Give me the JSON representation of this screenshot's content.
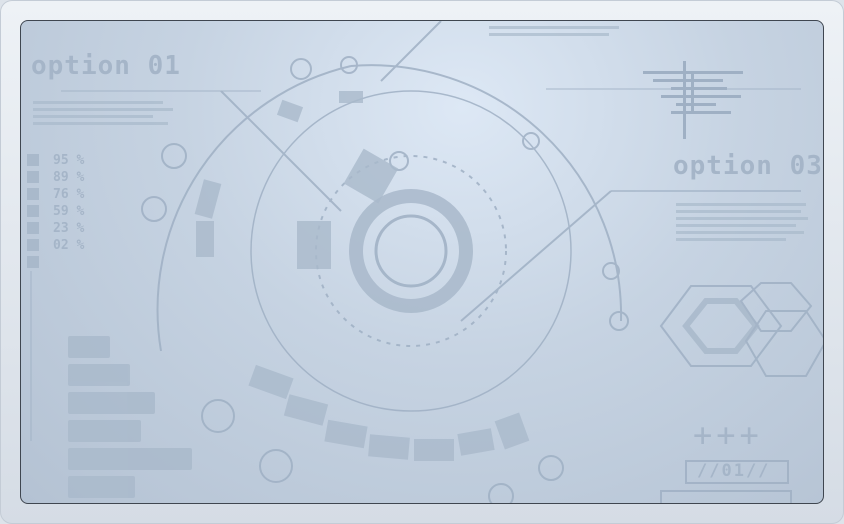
{
  "panel_left": {
    "title": "option 01",
    "percentages": [
      "95 %",
      "89 %",
      "76 %",
      "59 %",
      "23 %",
      "02 %"
    ]
  },
  "panel_right": {
    "title": "option 03",
    "code": "//01//",
    "plus_signs": "+++"
  },
  "colors": {
    "hud_line": "#9fb0c4",
    "hud_fill": "#a9b9cb",
    "bezel": "#e6ebf1",
    "screen_border": "#3f4650"
  }
}
